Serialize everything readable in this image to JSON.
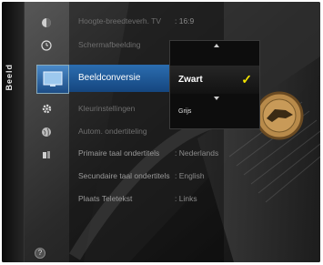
{
  "sidebar": {
    "section_label": "Beeld",
    "category_icons": [
      "picture-icon",
      "clock-icon",
      "tv-screen-icon",
      "gear-icon",
      "globe-icon",
      "speaker-icon"
    ],
    "help_icon": "question-icon"
  },
  "menu": {
    "items": [
      {
        "label": "Hoogte-breedteverh. TV",
        "value": ": 16:9"
      },
      {
        "label": "Schermafbeelding",
        "value": ""
      },
      {
        "label": "Beeldconversie",
        "value": ""
      },
      {
        "label": "Kleurinstellingen",
        "value": ""
      },
      {
        "label": "Autom. ondertiteling",
        "value": ""
      },
      {
        "label": "Primaire taal ondertitels",
        "value": ": Nederlands"
      },
      {
        "label": "Secundaire taal ondertitels",
        "value": ": English"
      },
      {
        "label": "Plaats Teletekst",
        "value": ": Links"
      }
    ]
  },
  "dropdown": {
    "options": [
      "Zwart",
      "Grijs"
    ],
    "selected": "Zwart"
  },
  "colors": {
    "highlight": "#1f5b9e",
    "check": "#f2e300"
  }
}
